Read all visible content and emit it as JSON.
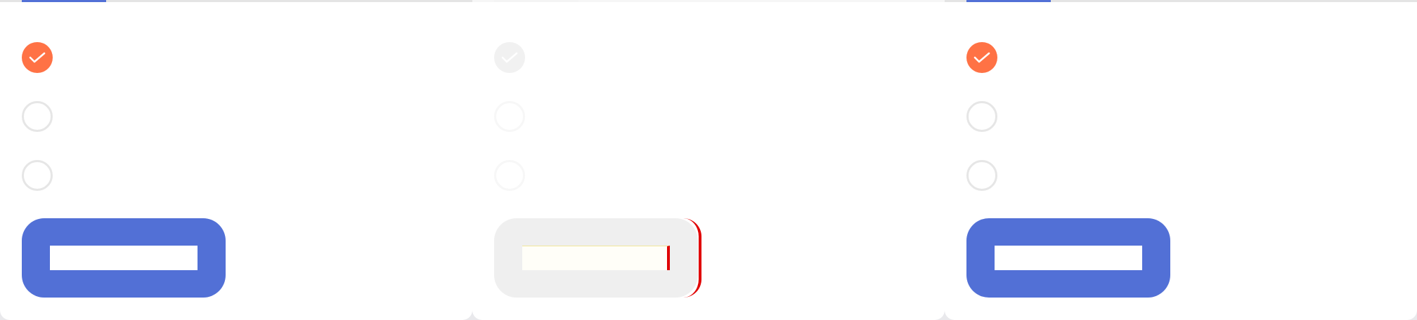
{
  "colors": {
    "accent": "#ff7245",
    "primary": "#5270d6",
    "disabled": "#efefef",
    "ring": "#e6e6e6"
  },
  "icons": {
    "check": "check-icon"
  },
  "panels": [
    {
      "state": "enabled",
      "options": [
        {
          "label": "",
          "checked": true
        },
        {
          "label": "",
          "checked": false
        },
        {
          "label": "",
          "checked": false
        }
      ],
      "submit_label": ""
    },
    {
      "state": "disabled",
      "options": [
        {
          "label": "",
          "checked": true
        },
        {
          "label": "",
          "checked": false
        },
        {
          "label": "",
          "checked": false
        }
      ],
      "submit_label": ""
    },
    {
      "state": "enabled",
      "options": [
        {
          "label": "",
          "checked": true
        },
        {
          "label": "",
          "checked": false
        },
        {
          "label": "",
          "checked": false
        }
      ],
      "submit_label": ""
    }
  ]
}
